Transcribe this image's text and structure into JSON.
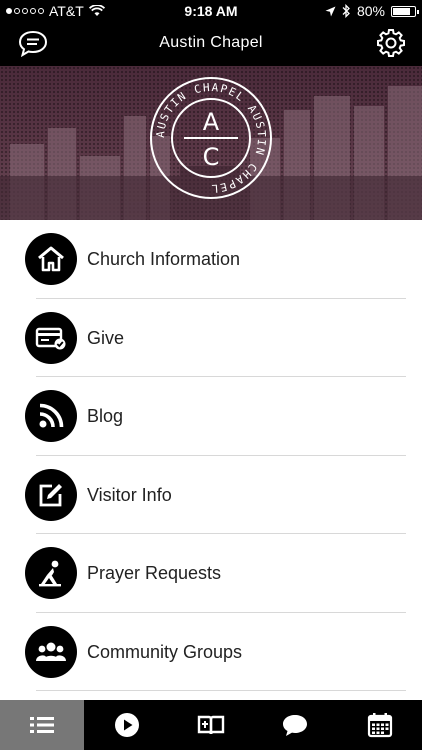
{
  "status_bar": {
    "carrier": "AT&T",
    "time": "9:18 AM",
    "battery": "80%",
    "battery_level": 0.8
  },
  "nav": {
    "title": "Austin Chapel",
    "left_icon": "chat-bubble-icon",
    "right_icon": "gear-icon"
  },
  "banner": {
    "logo_ring_text": "AUSTIN CHAPEL AUSTIN CHAPEL",
    "logo_letter_top": "A",
    "logo_letter_bottom": "C"
  },
  "menu": {
    "items": [
      {
        "label": "Church Information",
        "icon": "home-icon"
      },
      {
        "label": "Give",
        "icon": "credit-card-icon"
      },
      {
        "label": "Blog",
        "icon": "rss-icon"
      },
      {
        "label": "Visitor Info",
        "icon": "edit-icon"
      },
      {
        "label": "Prayer Requests",
        "icon": "praying-icon"
      },
      {
        "label": "Community Groups",
        "icon": "group-icon"
      }
    ]
  },
  "tabs": [
    {
      "name": "list-icon",
      "active": true
    },
    {
      "name": "play-icon",
      "active": false
    },
    {
      "name": "book-icon",
      "active": false
    },
    {
      "name": "speech-bubble-icon",
      "active": false
    },
    {
      "name": "calendar-icon",
      "active": false
    }
  ],
  "colors": {
    "bar": "#000000",
    "banner": "#5a3746",
    "active_tab": "#777777",
    "text": "#222222"
  }
}
